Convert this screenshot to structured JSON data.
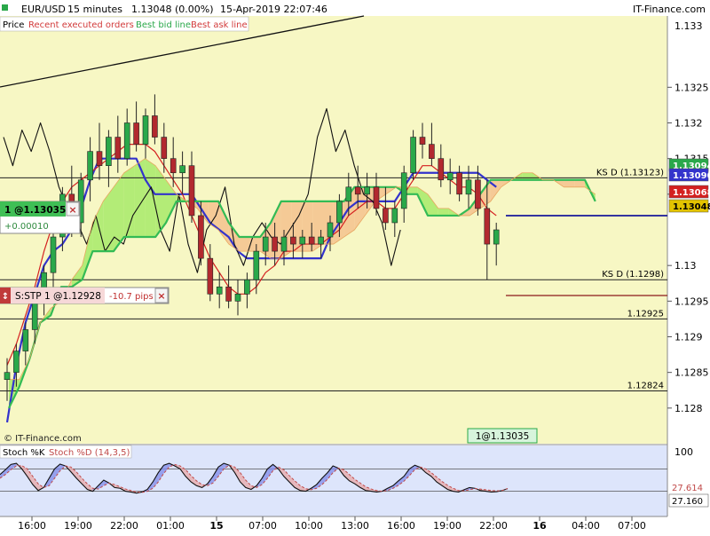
{
  "header": {
    "symbol": "EUR/USD",
    "interval": "15 minutes",
    "last_price": "1.13048 (0.00%)",
    "datetime": "15-Apr-2019 22:07:46",
    "brand": "IT-Finance.com"
  },
  "legend": {
    "price": "Price",
    "recent_orders": "Recent executed orders",
    "best_bid": "Best bid line",
    "best_ask": "Best ask line"
  },
  "colors": {
    "bg_main": "#f7f7c4",
    "bg_stoch": "#dde5fb",
    "candle_up": "#2aa84a",
    "candle_down": "#b2292f",
    "kijun": "#3333cc",
    "tenkan": "#d42020",
    "chikou": "#111111",
    "senkou": "#33bb55",
    "cloud_bear": "#f4c28e",
    "cloud_bull": "#a7ea6a",
    "bid_line": "#19199a",
    "ask_line": "#cc2222"
  },
  "position": {
    "label": "1 @1.13035",
    "pnl": "+0.00010",
    "close_icon": "x-icon"
  },
  "stop_order": {
    "label": "S:STP 1 @1.12928",
    "pips": "-10.7 pips",
    "close_icon": "x-icon"
  },
  "hlines": [
    {
      "value": 1.13123,
      "label": "KS D (1.13123)"
    },
    {
      "value": 1.1298,
      "label": "KS D (1.1298)"
    },
    {
      "value": 1.12925,
      "label": "1.12925"
    },
    {
      "value": 1.12824,
      "label": "1.12824"
    }
  ],
  "price_badges": [
    {
      "value": 1.13094,
      "label": "1.13094",
      "color": "#2aa84a"
    },
    {
      "value": 1.1309,
      "label": "1.13090",
      "color": "#3333cc"
    },
    {
      "value": 1.13068,
      "label": "1.13068",
      "color": "#d42020"
    },
    {
      "value": 1.13048,
      "label": "1.13048",
      "color": "#e3c300"
    }
  ],
  "fill_tag": "1@1.13035",
  "copyright": "© IT-Finance.com",
  "stoch": {
    "k_label": "Stoch %K",
    "d_label": "Stoch %D (14,3,5)",
    "top_label": "100",
    "k_value": "27.160",
    "d_value": "27.614"
  },
  "chart_data": {
    "type": "line",
    "title": "EUR/USD 15 minutes",
    "ylim": [
      1.1275,
      1.1335
    ],
    "y_ticks": [
      1.1325,
      1.132,
      1.1315,
      1.131,
      1.13,
      1.1295,
      1.129,
      1.1285,
      1.128
    ],
    "y_tick_labels": [
      "1.1325",
      "1.132",
      "1.1315",
      "1.131",
      "1.13",
      "1.1295",
      "1.129",
      "1.1285",
      "1.128"
    ],
    "y_top_label": "1.133",
    "x_ticks": [
      "16:00",
      "19:00",
      "22:00",
      "01:00",
      "15",
      "07:00",
      "10:00",
      "13:00",
      "16:00",
      "19:00",
      "22:00",
      "16",
      "04:00",
      "07:00"
    ],
    "candles": [
      {
        "o": 1.1284,
        "h": 1.1287,
        "l": 1.1281,
        "c": 1.1285
      },
      {
        "o": 1.1285,
        "h": 1.1289,
        "l": 1.1283,
        "c": 1.1288
      },
      {
        "o": 1.1288,
        "h": 1.1292,
        "l": 1.1286,
        "c": 1.1291
      },
      {
        "o": 1.1291,
        "h": 1.1296,
        "l": 1.1289,
        "c": 1.1295
      },
      {
        "o": 1.1295,
        "h": 1.13,
        "l": 1.1293,
        "c": 1.1299
      },
      {
        "o": 1.1299,
        "h": 1.1305,
        "l": 1.1297,
        "c": 1.1304
      },
      {
        "o": 1.1304,
        "h": 1.1311,
        "l": 1.1302,
        "c": 1.131
      },
      {
        "o": 1.131,
        "h": 1.1314,
        "l": 1.1304,
        "c": 1.1306
      },
      {
        "o": 1.1306,
        "h": 1.1313,
        "l": 1.1304,
        "c": 1.1312
      },
      {
        "o": 1.1312,
        "h": 1.1318,
        "l": 1.1309,
        "c": 1.1316
      },
      {
        "o": 1.1316,
        "h": 1.132,
        "l": 1.1312,
        "c": 1.1314
      },
      {
        "o": 1.1314,
        "h": 1.1319,
        "l": 1.1311,
        "c": 1.1318
      },
      {
        "o": 1.1318,
        "h": 1.1321,
        "l": 1.1313,
        "c": 1.1315
      },
      {
        "o": 1.1315,
        "h": 1.1322,
        "l": 1.1314,
        "c": 1.132
      },
      {
        "o": 1.132,
        "h": 1.1323,
        "l": 1.1316,
        "c": 1.1317
      },
      {
        "o": 1.1317,
        "h": 1.1322,
        "l": 1.1315,
        "c": 1.1321
      },
      {
        "o": 1.1321,
        "h": 1.1324,
        "l": 1.1317,
        "c": 1.1318
      },
      {
        "o": 1.1318,
        "h": 1.132,
        "l": 1.1313,
        "c": 1.1315
      },
      {
        "o": 1.1315,
        "h": 1.1318,
        "l": 1.1311,
        "c": 1.1313
      },
      {
        "o": 1.1313,
        "h": 1.1316,
        "l": 1.131,
        "c": 1.1314
      },
      {
        "o": 1.1314,
        "h": 1.1316,
        "l": 1.1306,
        "c": 1.1307
      },
      {
        "o": 1.1307,
        "h": 1.1309,
        "l": 1.13,
        "c": 1.1301
      },
      {
        "o": 1.1301,
        "h": 1.1303,
        "l": 1.1295,
        "c": 1.1296
      },
      {
        "o": 1.1296,
        "h": 1.1299,
        "l": 1.1294,
        "c": 1.1297
      },
      {
        "o": 1.1297,
        "h": 1.13,
        "l": 1.1294,
        "c": 1.1295
      },
      {
        "o": 1.1295,
        "h": 1.1298,
        "l": 1.1293,
        "c": 1.1296
      },
      {
        "o": 1.1296,
        "h": 1.1299,
        "l": 1.1294,
        "c": 1.1298
      },
      {
        "o": 1.1298,
        "h": 1.1303,
        "l": 1.1296,
        "c": 1.1302
      },
      {
        "o": 1.1302,
        "h": 1.1306,
        "l": 1.13,
        "c": 1.1304
      },
      {
        "o": 1.1304,
        "h": 1.1306,
        "l": 1.13,
        "c": 1.1302
      },
      {
        "o": 1.1302,
        "h": 1.1305,
        "l": 1.13,
        "c": 1.1304
      },
      {
        "o": 1.1304,
        "h": 1.1306,
        "l": 1.1301,
        "c": 1.1303
      },
      {
        "o": 1.1303,
        "h": 1.1305,
        "l": 1.1301,
        "c": 1.1304
      },
      {
        "o": 1.1304,
        "h": 1.1306,
        "l": 1.1302,
        "c": 1.1303
      },
      {
        "o": 1.1303,
        "h": 1.1305,
        "l": 1.1301,
        "c": 1.1304
      },
      {
        "o": 1.1304,
        "h": 1.1307,
        "l": 1.1302,
        "c": 1.1306
      },
      {
        "o": 1.1306,
        "h": 1.131,
        "l": 1.1304,
        "c": 1.1309
      },
      {
        "o": 1.1309,
        "h": 1.1313,
        "l": 1.1307,
        "c": 1.1311
      },
      {
        "o": 1.1311,
        "h": 1.1314,
        "l": 1.1308,
        "c": 1.131
      },
      {
        "o": 1.131,
        "h": 1.1313,
        "l": 1.1308,
        "c": 1.1311
      },
      {
        "o": 1.1311,
        "h": 1.1313,
        "l": 1.1307,
        "c": 1.1308
      },
      {
        "o": 1.1308,
        "h": 1.1311,
        "l": 1.1305,
        "c": 1.1306
      },
      {
        "o": 1.1306,
        "h": 1.1309,
        "l": 1.1304,
        "c": 1.1308
      },
      {
        "o": 1.1308,
        "h": 1.1314,
        "l": 1.1306,
        "c": 1.1313
      },
      {
        "o": 1.1313,
        "h": 1.1319,
        "l": 1.1312,
        "c": 1.1318
      },
      {
        "o": 1.1318,
        "h": 1.132,
        "l": 1.1315,
        "c": 1.1317
      },
      {
        "o": 1.1317,
        "h": 1.132,
        "l": 1.1314,
        "c": 1.1315
      },
      {
        "o": 1.1315,
        "h": 1.1317,
        "l": 1.1311,
        "c": 1.1312
      },
      {
        "o": 1.1312,
        "h": 1.1315,
        "l": 1.131,
        "c": 1.1313
      },
      {
        "o": 1.1313,
        "h": 1.1314,
        "l": 1.1309,
        "c": 1.131
      },
      {
        "o": 1.131,
        "h": 1.1314,
        "l": 1.1308,
        "c": 1.1312
      },
      {
        "o": 1.1312,
        "h": 1.1314,
        "l": 1.1307,
        "c": 1.1308
      },
      {
        "o": 1.1308,
        "h": 1.1312,
        "l": 1.1298,
        "c": 1.1303
      },
      {
        "o": 1.1303,
        "h": 1.1306,
        "l": 1.13,
        "c": 1.1305
      }
    ],
    "series": [
      {
        "name": "Kijun",
        "values": [
          1.1278,
          1.1286,
          1.1292,
          1.1296,
          1.13,
          1.1302,
          1.1303,
          1.1305,
          1.1308,
          1.1312,
          1.1315,
          1.1315,
          1.1315,
          1.1315,
          1.1315,
          1.1312,
          1.131,
          1.131,
          1.131,
          1.131,
          1.131,
          1.1308,
          1.1306,
          1.1305,
          1.1304,
          1.1302,
          1.1301,
          1.1301,
          1.1301,
          1.1301,
          1.1301,
          1.1301,
          1.1301,
          1.1301,
          1.1301,
          1.1304,
          1.1306,
          1.1308,
          1.1309,
          1.1309,
          1.1309,
          1.1309,
          1.1309,
          1.1311,
          1.1313,
          1.1313,
          1.1313,
          1.1313,
          1.1313,
          1.1313,
          1.1313,
          1.1313,
          1.1312,
          1.1311
        ]
      },
      {
        "name": "Tenkan",
        "values": [
          1.1286,
          1.1289,
          1.1293,
          1.1297,
          1.1302,
          1.1306,
          1.1309,
          1.1311,
          1.1312,
          1.1313,
          1.1314,
          1.1315,
          1.1316,
          1.1317,
          1.1317,
          1.1317,
          1.1316,
          1.1314,
          1.1312,
          1.131,
          1.1307,
          1.1304,
          1.1301,
          1.1299,
          1.1297,
          1.1296,
          1.1296,
          1.1297,
          1.1299,
          1.13,
          1.1302,
          1.1302,
          1.1303,
          1.1303,
          1.1303,
          1.1304,
          1.1305,
          1.1307,
          1.1308,
          1.1309,
          1.1309,
          1.1308,
          1.1308,
          1.131,
          1.1312,
          1.1314,
          1.1314,
          1.1313,
          1.1312,
          1.1311,
          1.1311,
          1.131,
          1.1308,
          1.1307
        ]
      },
      {
        "name": "Chikou",
        "values": [
          1.1318,
          1.1314,
          1.1319,
          1.1316,
          1.132,
          1.1316,
          1.1311,
          1.1308,
          1.1306,
          1.1303,
          1.1307,
          1.1302,
          1.1304,
          1.1303,
          1.1307,
          1.1309,
          1.1311,
          1.1305,
          1.1302,
          1.131,
          1.1303,
          1.1299,
          1.1305,
          1.1307,
          1.1311,
          1.1303,
          1.13,
          1.1304,
          1.1306,
          1.1304,
          1.1303,
          1.1305,
          1.1307,
          1.131,
          1.1318,
          1.1322,
          1.1316,
          1.1319,
          1.1314,
          1.131,
          1.1309,
          1.1306,
          1.13,
          1.1305
        ]
      },
      {
        "name": "Senkou B",
        "values": [
          1.128,
          1.1283,
          1.1287,
          1.1292,
          1.1293,
          1.1297,
          1.1297,
          1.1298,
          1.1302,
          1.1302,
          1.1302,
          1.1304,
          1.1304,
          1.1304,
          1.1304,
          1.1306,
          1.1309,
          1.1309,
          1.1309,
          1.1309,
          1.1309,
          1.1306,
          1.1304,
          1.1304,
          1.1304,
          1.1306,
          1.1309,
          1.1309,
          1.1309,
          1.1309,
          1.1309,
          1.1309,
          1.1309,
          1.1311,
          1.1311,
          1.1311,
          1.1311,
          1.1311,
          1.131,
          1.131,
          1.1307,
          1.1307,
          1.1307,
          1.1307,
          1.1308,
          1.131,
          1.1312,
          1.1312,
          1.1312,
          1.1312,
          1.1312,
          1.1312,
          1.1312,
          1.1312,
          1.1312,
          1.1312,
          1.1309
        ]
      },
      {
        "name": "Senkou A",
        "values": [
          1.1284,
          1.1284,
          1.1287,
          1.1292,
          1.1294,
          1.1295,
          1.1298,
          1.13,
          1.1306,
          1.1309,
          1.1311,
          1.1313,
          1.1314,
          1.1315,
          1.1314,
          1.1312,
          1.131,
          1.1309,
          1.1308,
          1.1306,
          1.1305,
          1.1303,
          1.1302,
          1.1302,
          1.1302,
          1.1301,
          1.1301,
          1.1302,
          1.1302,
          1.1302,
          1.1303,
          1.1303,
          1.1304,
          1.1305,
          1.1307,
          1.1309,
          1.131,
          1.1311,
          1.1311,
          1.1311,
          1.131,
          1.1308,
          1.1308,
          1.1307,
          1.1307,
          1.1308,
          1.1309,
          1.1311,
          1.1312,
          1.1313,
          1.1313,
          1.1312,
          1.1312,
          1.1311,
          1.1311,
          1.1311,
          1.131
        ]
      }
    ],
    "stoch_k": [
      65,
      78,
      92,
      95,
      80,
      60,
      38,
      22,
      30,
      55,
      80,
      93,
      88,
      72,
      55,
      40,
      25,
      20,
      35,
      50,
      42,
      30,
      28,
      20,
      18,
      15,
      18,
      25,
      45,
      70,
      90,
      95,
      88,
      80,
      60,
      45,
      35,
      30,
      40,
      60,
      85,
      95,
      90,
      70,
      45,
      30,
      25,
      35,
      55,
      80,
      92,
      80,
      60,
      45,
      30,
      22,
      20,
      28,
      38,
      55,
      70,
      88,
      82,
      62,
      48,
      40,
      30,
      22,
      20,
      18,
      20,
      28,
      35,
      48,
      60,
      80,
      90,
      84,
      70,
      60,
      45,
      35,
      25,
      20,
      18,
      24,
      30,
      28,
      22,
      20,
      18,
      19,
      22,
      27
    ],
    "stoch_d": [
      55,
      65,
      78,
      88,
      89,
      80,
      60,
      40,
      30,
      35,
      55,
      75,
      88,
      85,
      72,
      55,
      40,
      28,
      26,
      35,
      42,
      38,
      32,
      26,
      22,
      18,
      17,
      20,
      28,
      45,
      68,
      85,
      92,
      88,
      78,
      62,
      48,
      38,
      35,
      42,
      60,
      80,
      90,
      85,
      70,
      50,
      35,
      30,
      38,
      55,
      75,
      85,
      78,
      62,
      48,
      35,
      27,
      24,
      28,
      38,
      52,
      70,
      82,
      78,
      65,
      52,
      42,
      32,
      26,
      22,
      20,
      22,
      28,
      36,
      47,
      62,
      78,
      85,
      80,
      70,
      58,
      46,
      36,
      28,
      22,
      21,
      24,
      27,
      26,
      24,
      22,
      21,
      22,
      27.6
    ]
  }
}
